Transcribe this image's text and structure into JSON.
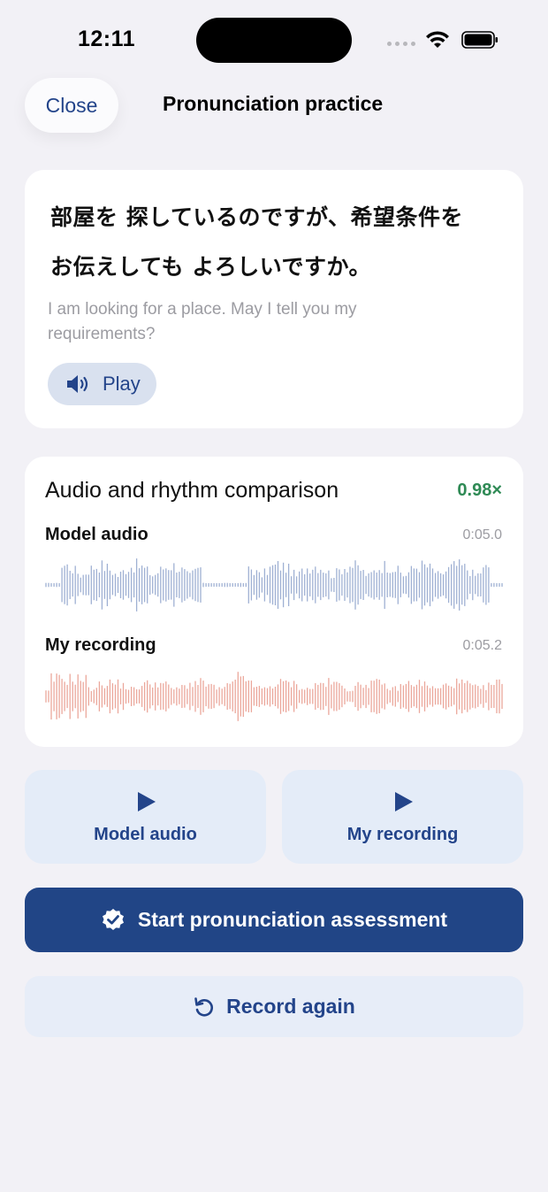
{
  "status_bar": {
    "time": "12:11"
  },
  "header": {
    "close_label": "Close",
    "title": "Pronunciation practice"
  },
  "sentence": {
    "japanese_line1": "部屋を 探しているのですが、希望条件を",
    "japanese_line2": "お伝えしても よろしいですか。",
    "translation": "I am looking for a place. May I tell you my requirements?",
    "play_label": "Play"
  },
  "comparison": {
    "title": "Audio and rhythm comparison",
    "ratio": "0.98×",
    "model": {
      "label": "Model audio",
      "duration": "0:05.0",
      "color": "#9fb0d3"
    },
    "mine": {
      "label": "My recording",
      "duration": "0:05.2",
      "color": "#eba79b"
    }
  },
  "playback": {
    "model_label": "Model audio",
    "mine_label": "My recording"
  },
  "actions": {
    "assess_label": "Start pronunciation assessment",
    "record_again_label": "Record again"
  },
  "colors": {
    "accent": "#214586",
    "ratio_green": "#2f8a55",
    "background": "#f2f1f6"
  }
}
